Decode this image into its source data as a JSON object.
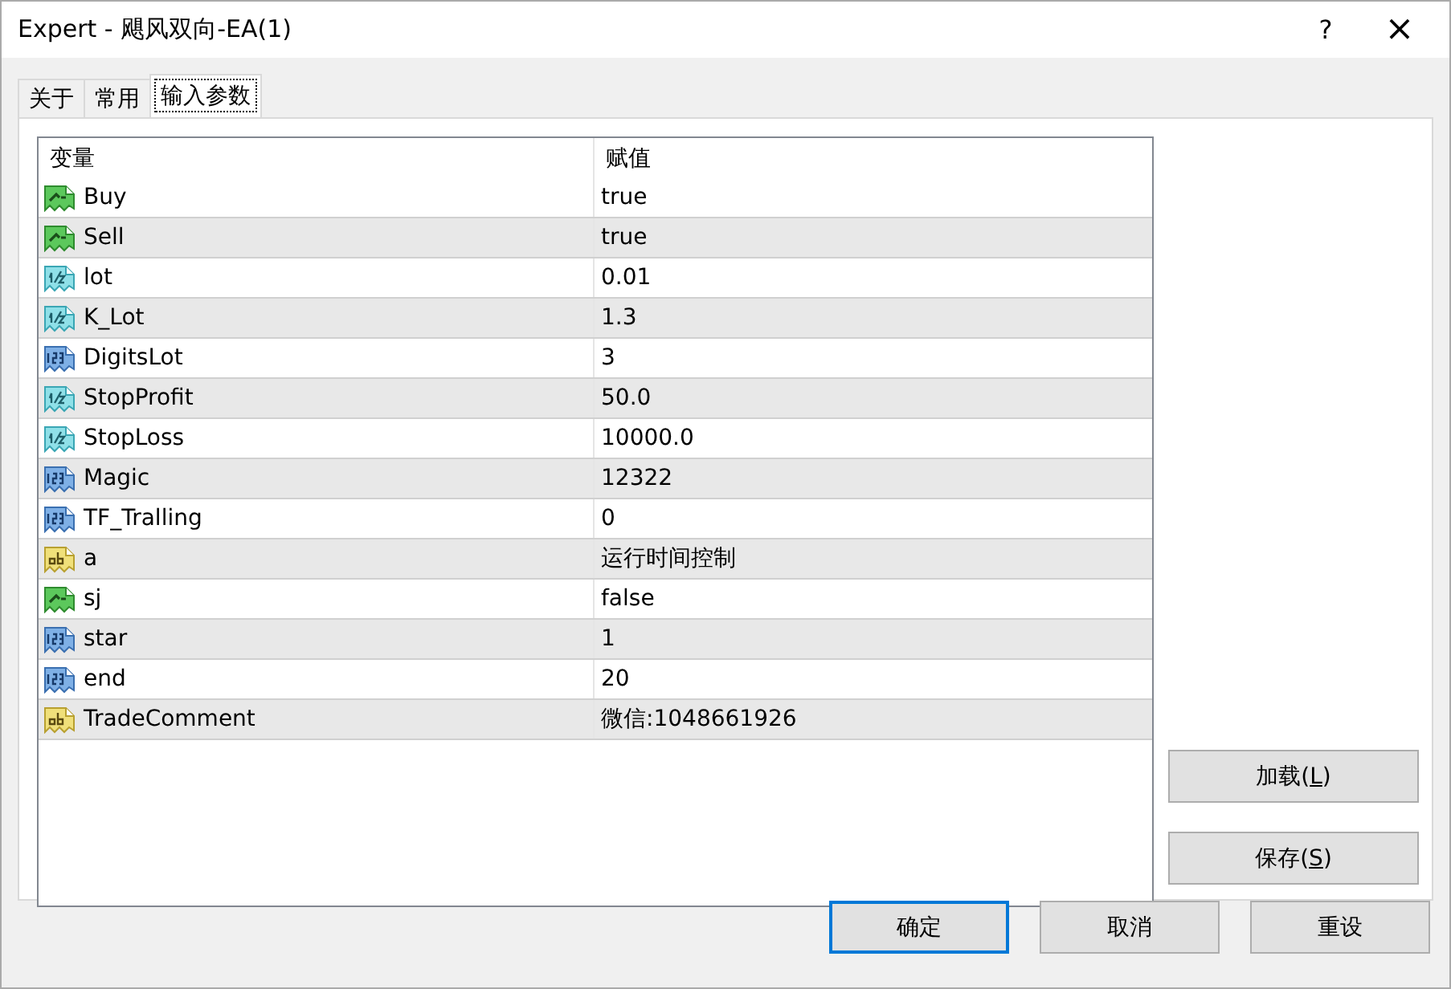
{
  "window": {
    "title": "Expert - 飓风双向-EA(1)",
    "help": "?",
    "close": "×"
  },
  "tabs": [
    {
      "label": "关于",
      "selected": false
    },
    {
      "label": "常用",
      "selected": false
    },
    {
      "label": "输入参数",
      "selected": true
    }
  ],
  "table": {
    "columns": [
      "变量",
      "赋值"
    ],
    "rows": [
      {
        "kind": "bool",
        "name": "Buy",
        "value": "true"
      },
      {
        "kind": "bool",
        "name": "Sell",
        "value": "true"
      },
      {
        "kind": "double",
        "name": "lot",
        "value": "0.01"
      },
      {
        "kind": "double",
        "name": "K_Lot",
        "value": "1.3"
      },
      {
        "kind": "int",
        "name": "DigitsLot",
        "value": "3"
      },
      {
        "kind": "double",
        "name": "StopProfit",
        "value": "50.0"
      },
      {
        "kind": "double",
        "name": "StopLoss",
        "value": "10000.0"
      },
      {
        "kind": "int",
        "name": "Magic",
        "value": "12322"
      },
      {
        "kind": "int",
        "name": "TF_Tralling",
        "value": "0"
      },
      {
        "kind": "string",
        "name": "a",
        "value": "运行时间控制"
      },
      {
        "kind": "bool",
        "name": "sj",
        "value": "false"
      },
      {
        "kind": "int",
        "name": "star",
        "value": "1"
      },
      {
        "kind": "int",
        "name": "end",
        "value": "20"
      },
      {
        "kind": "string",
        "name": "TradeComment",
        "value": "微信:1048661926"
      }
    ]
  },
  "side_buttons": [
    {
      "before": "加载(",
      "key": "L",
      "after": ")"
    },
    {
      "before": "保存(",
      "key": "S",
      "after": ")"
    }
  ],
  "buttons": [
    {
      "label": "确定",
      "selected": true
    },
    {
      "label": "取消",
      "selected": false
    },
    {
      "label": "重设",
      "selected": false
    }
  ]
}
